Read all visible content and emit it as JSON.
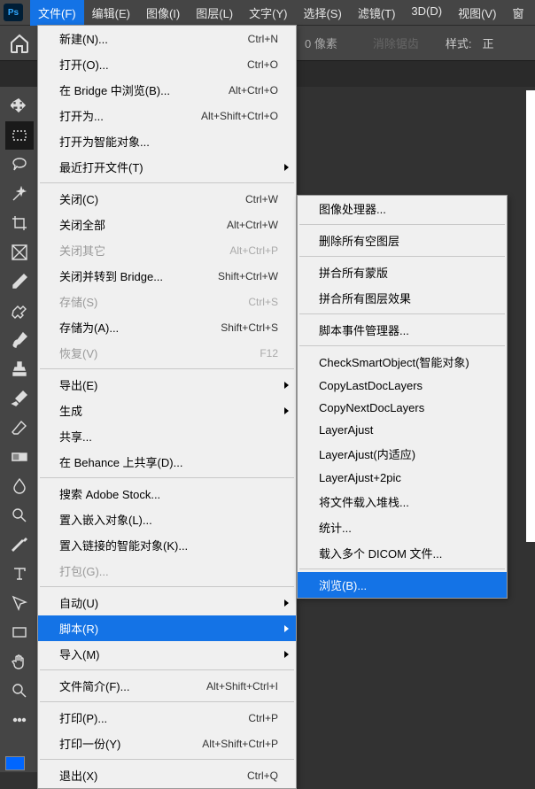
{
  "app": {
    "logo": "Ps"
  },
  "menubar": {
    "items": [
      "文件(F)",
      "编辑(E)",
      "图像(I)",
      "图层(L)",
      "文字(Y)",
      "选择(S)",
      "滤镜(T)",
      "3D(D)",
      "视图(V)",
      "窗"
    ]
  },
  "options": {
    "pixels": "0 像素",
    "antialias": "消除锯齿",
    "style": "样式:",
    "square": "正"
  },
  "file_menu": [
    {
      "type": "item",
      "label": "新建(N)...",
      "shortcut": "Ctrl+N"
    },
    {
      "type": "item",
      "label": "打开(O)...",
      "shortcut": "Ctrl+O"
    },
    {
      "type": "item",
      "label": "在 Bridge 中浏览(B)...",
      "shortcut": "Alt+Ctrl+O"
    },
    {
      "type": "item",
      "label": "打开为...",
      "shortcut": "Alt+Shift+Ctrl+O"
    },
    {
      "type": "item",
      "label": "打开为智能对象..."
    },
    {
      "type": "item",
      "label": "最近打开文件(T)",
      "submenu": true
    },
    {
      "type": "sep"
    },
    {
      "type": "item",
      "label": "关闭(C)",
      "shortcut": "Ctrl+W"
    },
    {
      "type": "item",
      "label": "关闭全部",
      "shortcut": "Alt+Ctrl+W"
    },
    {
      "type": "item",
      "label": "关闭其它",
      "shortcut": "Alt+Ctrl+P",
      "disabled": true
    },
    {
      "type": "item",
      "label": "关闭并转到 Bridge...",
      "shortcut": "Shift+Ctrl+W"
    },
    {
      "type": "item",
      "label": "存储(S)",
      "shortcut": "Ctrl+S",
      "disabled": true
    },
    {
      "type": "item",
      "label": "存储为(A)...",
      "shortcut": "Shift+Ctrl+S"
    },
    {
      "type": "item",
      "label": "恢复(V)",
      "shortcut": "F12",
      "disabled": true
    },
    {
      "type": "sep"
    },
    {
      "type": "item",
      "label": "导出(E)",
      "submenu": true
    },
    {
      "type": "item",
      "label": "生成",
      "submenu": true
    },
    {
      "type": "item",
      "label": "共享..."
    },
    {
      "type": "item",
      "label": "在 Behance 上共享(D)..."
    },
    {
      "type": "sep"
    },
    {
      "type": "item",
      "label": "搜索 Adobe Stock..."
    },
    {
      "type": "item",
      "label": "置入嵌入对象(L)..."
    },
    {
      "type": "item",
      "label": "置入链接的智能对象(K)..."
    },
    {
      "type": "item",
      "label": "打包(G)...",
      "disabled": true
    },
    {
      "type": "sep"
    },
    {
      "type": "item",
      "label": "自动(U)",
      "submenu": true
    },
    {
      "type": "item",
      "label": "脚本(R)",
      "submenu": true,
      "highlight": true
    },
    {
      "type": "item",
      "label": "导入(M)",
      "submenu": true
    },
    {
      "type": "sep"
    },
    {
      "type": "item",
      "label": "文件简介(F)...",
      "shortcut": "Alt+Shift+Ctrl+I"
    },
    {
      "type": "sep"
    },
    {
      "type": "item",
      "label": "打印(P)...",
      "shortcut": "Ctrl+P"
    },
    {
      "type": "item",
      "label": "打印一份(Y)",
      "shortcut": "Alt+Shift+Ctrl+P"
    },
    {
      "type": "sep"
    },
    {
      "type": "item",
      "label": "退出(X)",
      "shortcut": "Ctrl+Q"
    }
  ],
  "script_menu": [
    {
      "type": "item",
      "label": "图像处理器..."
    },
    {
      "type": "sep"
    },
    {
      "type": "item",
      "label": "删除所有空图层"
    },
    {
      "type": "sep"
    },
    {
      "type": "item",
      "label": "拼合所有蒙版"
    },
    {
      "type": "item",
      "label": "拼合所有图层效果"
    },
    {
      "type": "sep"
    },
    {
      "type": "item",
      "label": "脚本事件管理器..."
    },
    {
      "type": "sep"
    },
    {
      "type": "item",
      "label": "CheckSmartObject(智能对象)"
    },
    {
      "type": "item",
      "label": "CopyLastDocLayers"
    },
    {
      "type": "item",
      "label": "CopyNextDocLayers"
    },
    {
      "type": "item",
      "label": "LayerAjust"
    },
    {
      "type": "item",
      "label": "LayerAjust(内适应)"
    },
    {
      "type": "item",
      "label": "LayerAjust+2pic"
    },
    {
      "type": "item",
      "label": "将文件载入堆栈..."
    },
    {
      "type": "item",
      "label": "统计..."
    },
    {
      "type": "item",
      "label": "载入多个 DICOM 文件..."
    },
    {
      "type": "sep"
    },
    {
      "type": "item",
      "label": "浏览(B)...",
      "highlight": true
    }
  ],
  "tools": [
    "move",
    "marquee",
    "lasso",
    "wand",
    "crop",
    "frame",
    "eyedropper",
    "healing",
    "brush",
    "stamp",
    "history",
    "eraser",
    "gradient",
    "blur",
    "dodge",
    "pen",
    "type",
    "path",
    "rectangle",
    "hand",
    "zoom",
    "more"
  ]
}
